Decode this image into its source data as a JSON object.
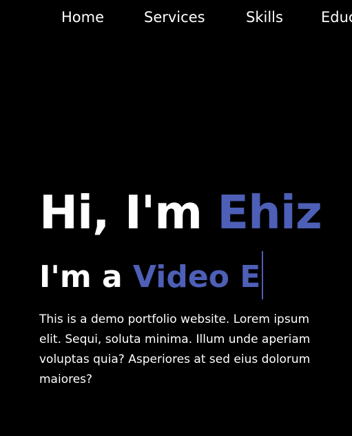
{
  "nav": {
    "items": [
      {
        "label": "Home"
      },
      {
        "label": "Services"
      },
      {
        "label": "Skills"
      },
      {
        "label": "Educ"
      }
    ]
  },
  "hero": {
    "greeting": "Hi, I'm ",
    "name": "Ehiz",
    "role_prefix": "I'm a ",
    "role_typed": "Video E",
    "description_lines": [
      "This is a demo portfolio website. Lorem ipsum",
      "elit. Sequi, soluta minima. Illum unde aperiam",
      "voluptas quia? Asperiores at sed eius dolorum",
      "maiores?"
    ]
  },
  "colors": {
    "background": "#000000",
    "text": "#ffffff",
    "accent": "#4e5fb7"
  }
}
